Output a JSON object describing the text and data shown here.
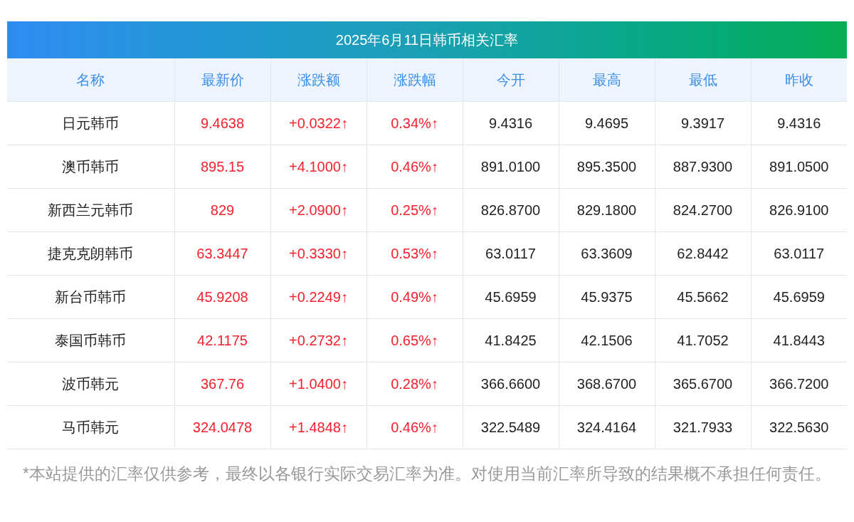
{
  "title": "2025年6月11日韩币相关汇率",
  "columns": [
    {
      "label": "名称",
      "emphasis": false
    },
    {
      "label": "最新价",
      "emphasis": true
    },
    {
      "label": "涨跌额",
      "emphasis": true
    },
    {
      "label": "涨跌幅",
      "emphasis": true
    },
    {
      "label": "今开",
      "emphasis": false
    },
    {
      "label": "最高",
      "emphasis": false
    },
    {
      "label": "最低",
      "emphasis": false
    },
    {
      "label": "昨收",
      "emphasis": false
    }
  ],
  "rows": [
    [
      "日元韩币",
      "9.4638",
      "+0.0322↑",
      "0.34%↑",
      "9.4316",
      "9.4695",
      "9.3917",
      "9.4316"
    ],
    [
      "澳币韩币",
      "895.15",
      "+4.1000↑",
      "0.46%↑",
      "891.0100",
      "895.3500",
      "887.9300",
      "891.0500"
    ],
    [
      "新西兰元韩币",
      "829",
      "+2.0900↑",
      "0.25%↑",
      "826.8700",
      "829.1800",
      "824.2700",
      "826.9100"
    ],
    [
      "捷克克朗韩币",
      "63.3447",
      "+0.3330↑",
      "0.53%↑",
      "63.0117",
      "63.3609",
      "62.8442",
      "63.0117"
    ],
    [
      "新台币韩币",
      "45.9208",
      "+0.2249↑",
      "0.49%↑",
      "45.6959",
      "45.9375",
      "45.5662",
      "45.6959"
    ],
    [
      "泰国币韩币",
      "42.1175",
      "+0.2732↑",
      "0.65%↑",
      "41.8425",
      "42.1506",
      "41.7052",
      "41.8443"
    ],
    [
      "波币韩元",
      "367.76",
      "+1.0400↑",
      "0.28%↑",
      "366.6600",
      "368.6700",
      "365.6700",
      "366.7200"
    ],
    [
      "马币韩元",
      "324.0478",
      "+1.4848↑",
      "0.46%↑",
      "322.5489",
      "324.4164",
      "321.7933",
      "322.5630"
    ]
  ],
  "footnote": "*本站提供的汇率仅供参考，最终以各银行实际交易汇率为准。对使用当前汇率所导致的结果概不承担任何责任。"
}
